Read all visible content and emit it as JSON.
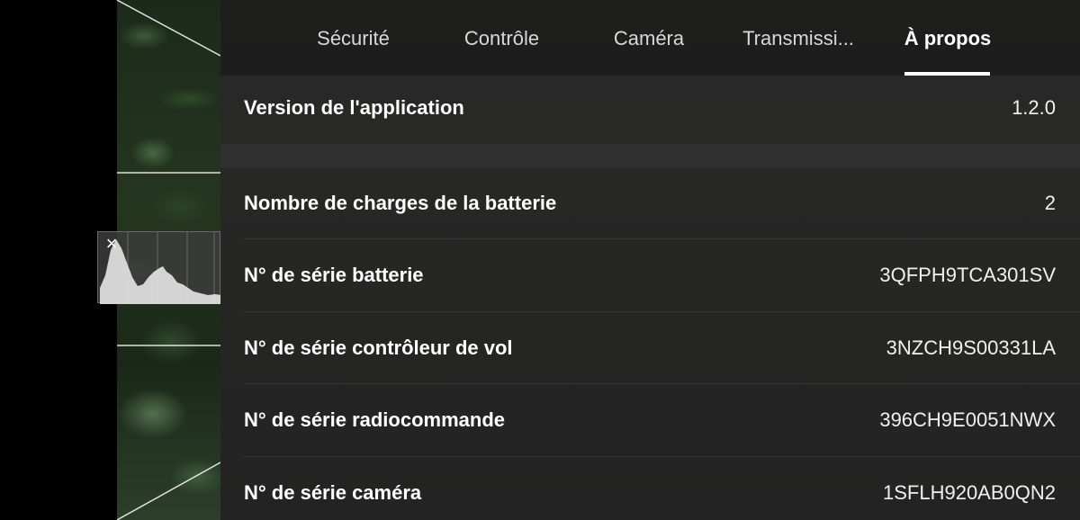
{
  "tabs": [
    {
      "label": "Sécurité"
    },
    {
      "label": "Contrôle"
    },
    {
      "label": "Caméra"
    },
    {
      "label": "Transmissi..."
    },
    {
      "label": "À propos",
      "active": true
    }
  ],
  "about": {
    "app_version": {
      "label": "Version de l'application",
      "value": "1.2.0"
    },
    "rows": [
      {
        "label": "Nombre de charges de la batterie",
        "value": "2"
      },
      {
        "label": "N° de série batterie",
        "value": "3QFPH9TCA301SV"
      },
      {
        "label": "N° de série contrôleur de vol",
        "value": "3NZCH9S00331LA"
      },
      {
        "label": "N° de série radiocommande",
        "value": "396CH9E0051NWX"
      },
      {
        "label": "N° de série caméra",
        "value": "1SFLH920AB0QN2"
      }
    ]
  },
  "histogram": {
    "close_icon": "close-icon",
    "close_glyph": "×"
  },
  "colors": {
    "panel_bg": "#262625",
    "tab_active": "#ffffff",
    "tab_inactive": "#d8d8d8"
  }
}
